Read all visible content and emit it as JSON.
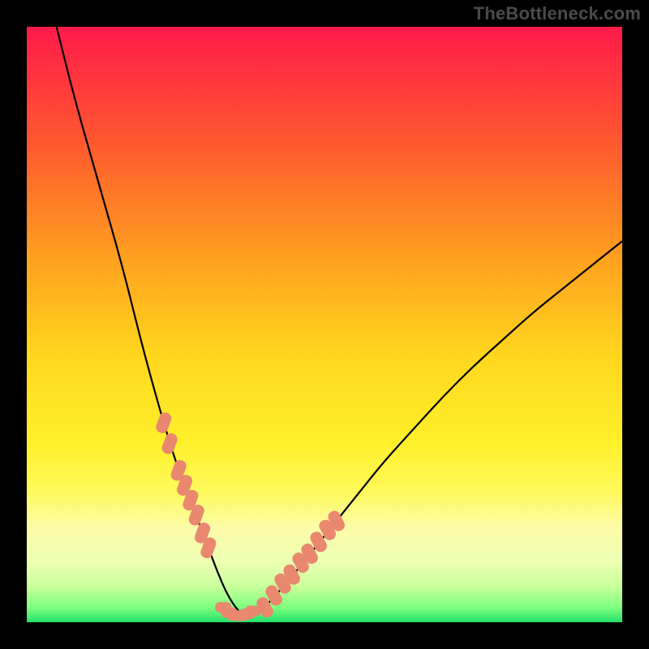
{
  "watermark": "TheBottleneck.com",
  "colors": {
    "frame": "#000000",
    "curve": "#000000",
    "marker": "#e9886f",
    "gradient_stops": [
      {
        "offset": 0.0,
        "color": "#ff1a4a"
      },
      {
        "offset": 0.2,
        "color": "#ff5a2e"
      },
      {
        "offset": 0.4,
        "color": "#ffa41e"
      },
      {
        "offset": 0.55,
        "color": "#ffd61e"
      },
      {
        "offset": 0.7,
        "color": "#fff02a"
      },
      {
        "offset": 0.78,
        "color": "#fff95a"
      },
      {
        "offset": 0.84,
        "color": "#fdfca8"
      },
      {
        "offset": 0.9,
        "color": "#ecffb2"
      },
      {
        "offset": 0.94,
        "color": "#c8ff9a"
      },
      {
        "offset": 0.975,
        "color": "#7fff80"
      },
      {
        "offset": 1.0,
        "color": "#24e06a"
      }
    ]
  },
  "chart_data": {
    "type": "line",
    "title": "",
    "xlabel": "",
    "ylabel": "",
    "x_range": [
      0,
      100
    ],
    "y_range": [
      0,
      100
    ],
    "series": [
      {
        "name": "curve",
        "x": [
          5,
          8,
          12,
          16,
          19,
          21,
          23,
          25,
          27,
          29,
          30.5,
          32,
          33.5,
          35,
          36.5,
          38,
          40,
          44,
          48,
          52,
          56,
          60,
          65,
          70,
          75,
          80,
          85,
          90,
          95,
          100
        ],
        "y": [
          100,
          88,
          74,
          60,
          48,
          40.5,
          33.5,
          27,
          21.5,
          16.5,
          12.5,
          8.5,
          5,
          2.5,
          1,
          1,
          2.5,
          7,
          12,
          17,
          22,
          27,
          32.5,
          38,
          43,
          47.5,
          52,
          56,
          60,
          64
        ]
      }
    ],
    "markers": {
      "left_segment": {
        "x": [
          23,
          24,
          25.5,
          26.5,
          27.5,
          28.5,
          29.5,
          30.5
        ],
        "y": [
          33.5,
          30,
          25.5,
          23,
          20.5,
          18,
          15,
          12.5
        ]
      },
      "right_segment": {
        "x": [
          40,
          41.5,
          43,
          44.5,
          46,
          47.5,
          49,
          50.5,
          52
        ],
        "y": [
          2.5,
          4.5,
          6.5,
          8,
          10,
          11.5,
          13.5,
          15.5,
          17
        ]
      },
      "floor_cluster": {
        "x": [
          33,
          34,
          35,
          36,
          37,
          38
        ],
        "y": [
          2.5,
          1.6,
          1.1,
          1.1,
          1.4,
          1.9
        ]
      }
    }
  }
}
